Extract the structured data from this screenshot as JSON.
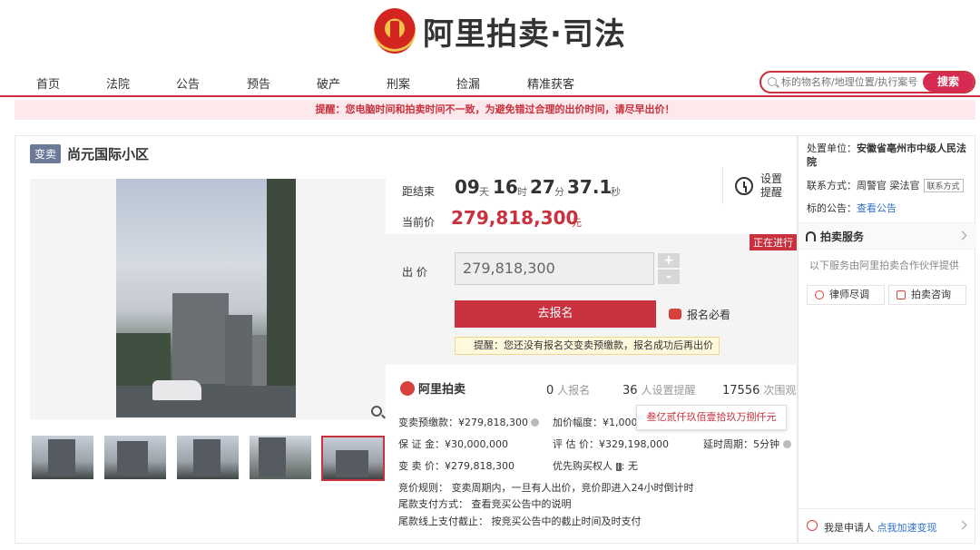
{
  "header": {
    "logo_text": "阿里拍卖·司法"
  },
  "nav": {
    "items": [
      "首页",
      "法院",
      "公告",
      "预告",
      "破产",
      "刑案",
      "捡漏",
      "精准获客"
    ]
  },
  "search": {
    "placeholder": "标的物名称/地理位置/执行案号",
    "button": "搜索"
  },
  "notice": "提醒：您电脑时间和拍卖时间不一致，为避免错过合理的出价时间，请尽早出价！",
  "item": {
    "tag": "变卖",
    "title": "尚元国际小区"
  },
  "countdown": {
    "label": "距结束",
    "days": "09",
    "days_unit": "天",
    "hours": "16",
    "hours_unit": "时",
    "minutes": "27",
    "minutes_unit": "分",
    "seconds": "37.1",
    "seconds_unit": "秒"
  },
  "remind": {
    "label": "设置提醒"
  },
  "price": {
    "label": "当前价",
    "value": "279,818,300",
    "unit": "元"
  },
  "status": "正在进行",
  "bid": {
    "label": "出 价",
    "value": "279,818,300",
    "plus": "+",
    "minus": "-",
    "signup": "去报名",
    "must_read": "报名必看",
    "tip": "提醒：您还没有报名交变卖预缴款，报名成功后再出价"
  },
  "partner": {
    "name": "阿里拍卖"
  },
  "stats": {
    "signups": "0",
    "signups_label": "人报名",
    "reminders": "36",
    "reminders_label": "人设置提醒",
    "views": "17556",
    "views_label": "次围观"
  },
  "tooltip": "叁亿贰仟玖佰壹拾玖万捌仟元",
  "details": {
    "deposit": "变卖预缴款：¥279,818,300",
    "increment": "加价幅度：¥1,000,0",
    "guarantee": "保 证 金：¥30,000,000",
    "appraisal": "评 估 价：¥329,198,000",
    "delay": "延时周期：5分钟",
    "sale_price": "变 卖 价：¥279,818,300",
    "priority": "优先购买权人",
    "priority_value": "无",
    "rule": "竞价规则：  变卖周期内，一旦有人出价，竞价即进入24小时倒计时",
    "payment": "尾款支付方式：  查看竞买公告中的说明",
    "deadline": "尾款线上支付截止：  按竞买公告中的截止时间及时支付"
  },
  "sidebar": {
    "unit_label": "处置单位：",
    "unit_value": "安徽省亳州市中级人民法院",
    "contact_label": "联系方式：",
    "contact_value": "周警官 梁法官",
    "contact_tag": "联系方式",
    "notice_label": "标的公告：",
    "notice_link": "查看公告",
    "service_title": "拍卖服务",
    "service_desc": "以下服务由阿里拍卖合作伙伴提供",
    "lawyer": "律师尽调",
    "consult": "拍卖咨询",
    "applicant": "我是申请人",
    "applicant_link": "点我加速变现"
  }
}
